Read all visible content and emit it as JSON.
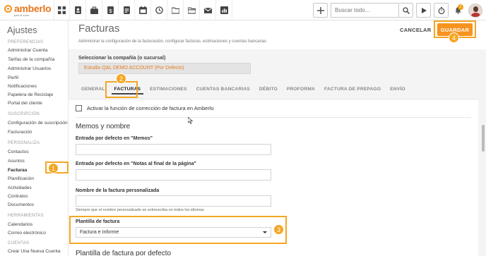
{
  "app": {
    "logo_text": "amberlo",
    "logo_sub": "part of zone"
  },
  "topbar": {
    "nav_icons": [
      "grid-icon",
      "contact-card-icon",
      "briefcase-icon",
      "invoice-icon",
      "document-icon",
      "calendar-icon",
      "history-icon",
      "folder-icon",
      "folder-alt-icon",
      "mail-icon",
      "chart-icon"
    ],
    "search_placeholder": "Buscar todo...",
    "notification_count": "2"
  },
  "sidebar": {
    "title": "Ajustes",
    "sections": [
      {
        "label": "PREFERENCIAS",
        "items": [
          "Administrar Cuenta",
          "Tarifas de la compañía",
          "Administrar Usuarios",
          "Perfil",
          "Notificaciones",
          "Papelera de Reciclaje",
          "Portal del cliente"
        ]
      },
      {
        "label": "SUSCRIPCIÓN",
        "items": [
          "Configuración de suscripción",
          "Facturación"
        ]
      },
      {
        "label": "PERSONALIZA",
        "items": [
          "Contactos",
          "Asuntos",
          "Facturas",
          "Planificación",
          "Actividades",
          "Contratos",
          "Documentos"
        ]
      },
      {
        "label": "HERRAMIENTAS",
        "items": [
          "Calendarios",
          "Correo electrónico"
        ]
      },
      {
        "label": "CUENTAS",
        "items": [
          "Crear Una Nueva Cuenta"
        ]
      }
    ],
    "active_item": "Facturas"
  },
  "main": {
    "title": "Facturas",
    "subtitle": "Administrar la configuración de la facturación, configurar facturas, estimaciones y cuentas bancarias",
    "cancel_label": "CANCELAR",
    "save_label": "GUARDAR",
    "company_label": "Seleccionar la compañía (o sucursal)",
    "company_value": "Estudio Q&L DEMO ACCOUNT (Por Defecto)",
    "tabs": [
      "GENERAL",
      "FACTURAS",
      "ESTIMACIONES",
      "CUENTAS BANCARIAS",
      "DÉBITO",
      "PROFORMA",
      "FACTURA DE PREPAGO",
      "ENVÍO"
    ],
    "active_tab": "FACTURAS",
    "correction_checkbox_label": "Activar la función de corrección de factura en Amberlo",
    "correction_checked": false,
    "memos_heading": "Memos y nombre",
    "memos_label": "Entrada por defecto en \"Memos\"",
    "memos_value": "",
    "notes_label": "Entrada por defecto en \"Notas al final de la página\"",
    "notes_value": "",
    "custom_name_label": "Nombre de la factura personalizada",
    "custom_name_value": "",
    "custom_name_help": "Siempre que el nombre personalizado se sobrescriba en todos los idiomas",
    "template_label": "Plantilla de factura",
    "template_value": "Factura e Informe",
    "default_template_heading": "Plantilla de factura por defecto"
  },
  "annotations": {
    "callouts": [
      "1",
      "2",
      "3",
      "4"
    ],
    "color": "#f5a623"
  },
  "colors": {
    "brand": "#f7931e",
    "accent": "#e67e22"
  }
}
